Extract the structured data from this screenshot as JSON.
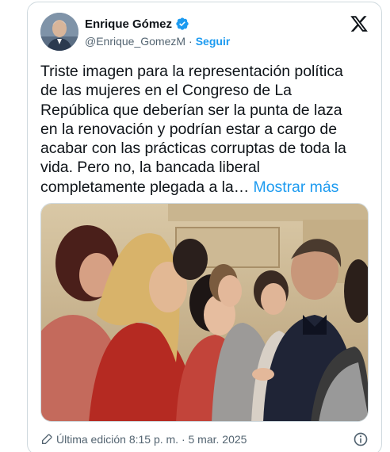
{
  "author": {
    "name": "Enrique Gómez",
    "handle": "@Enrique_GomezM",
    "separator": "·",
    "follow_label": "Seguir"
  },
  "tweet": {
    "text": "Triste imagen para la representación política de las mujeres en el Congreso de La República que deberían ser la punta de laza en la renovación y podrían estar a cargo de acabar con las prácticas corruptas de toda la vida. Pero no, la bancada liberal completamente plegada a la…",
    "show_more_label": "Mostrar más"
  },
  "footer": {
    "edited_label": "Última edición 8:15 p. m. · 5 mar. 2025"
  },
  "icons": {
    "verified": "verified-badge-icon",
    "brand": "x-logo-icon",
    "edit": "pencil-icon",
    "info": "info-icon"
  },
  "colors": {
    "accent": "#1d9bf0",
    "text": "#0f1419",
    "secondary": "#536471",
    "border": "#cfd9de"
  }
}
